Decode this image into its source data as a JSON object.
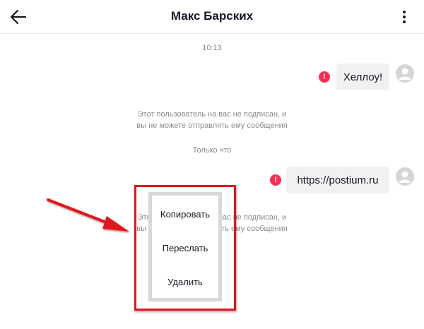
{
  "header": {
    "title": "Макс Барских"
  },
  "chat": {
    "timestamps": [
      "10:13",
      "Только что"
    ],
    "messages": [
      {
        "text": "Хеллоу!",
        "status": "error"
      },
      {
        "text": "https://postium.ru",
        "status": "error"
      }
    ],
    "system_notices": [
      {
        "line1": "Этот пользователь на вас не подписан, и",
        "line2": "вы не можете отправлять ему сообщения"
      },
      {
        "line1": "Этот пользователь на вас не подписан, и",
        "line2": "вы не можете отправлять ему сообщения"
      }
    ],
    "error_glyph": "!"
  },
  "context_menu": {
    "items": [
      "Копировать",
      "Переслать",
      "Удалить"
    ]
  },
  "colors": {
    "accent_error": "#fe2c55",
    "annotation_red": "#e3141c",
    "bubble_bg": "#f1f1f2"
  },
  "icons": {
    "back": "arrow-left-icon",
    "more": "vertical-dots-icon",
    "avatar": "user-avatar-icon"
  }
}
